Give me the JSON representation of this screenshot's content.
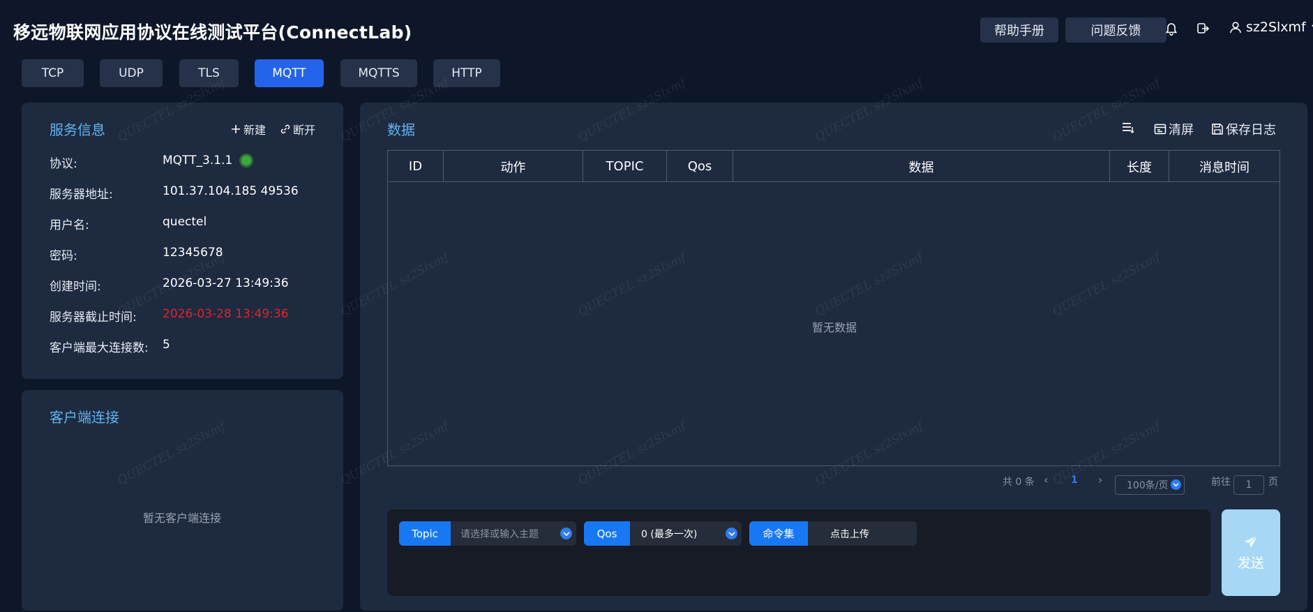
{
  "header": {
    "title": "移远物联网应用协议在线测试平台(ConnectLab)",
    "help_label": "帮助手册",
    "feedback_label": "问题反馈",
    "username": "sz2Slxmf"
  },
  "tabs": [
    {
      "label": "TCP",
      "active": false
    },
    {
      "label": "UDP",
      "active": false
    },
    {
      "label": "TLS",
      "active": false
    },
    {
      "label": "MQTT",
      "active": true
    },
    {
      "label": "MQTTS",
      "active": false
    },
    {
      "label": "HTTP",
      "active": false
    }
  ],
  "service": {
    "title": "服务信息",
    "new_label": "新建",
    "disconnect_label": "断开",
    "rows": [
      {
        "label": "协议:",
        "value": "MQTT_3.1.1"
      },
      {
        "label": "服务器地址:",
        "value": "101.37.104.185 49536"
      },
      {
        "label": "用户名:",
        "value": "quectel"
      },
      {
        "label": "密码:",
        "value": "12345678"
      },
      {
        "label": "创建时间:",
        "value": "2026-03-27 13:49:36"
      },
      {
        "label": "服务器截止时间:",
        "value": "2026-03-28 13:49:36"
      },
      {
        "label": "客户端最大连接数:",
        "value": "5"
      }
    ],
    "status_color": "#3aa83f",
    "expiry_color": "#e0242b"
  },
  "clients": {
    "title": "客户端连接",
    "empty_text": "暂无客户端连接"
  },
  "data_panel": {
    "title": "数据",
    "clear_label": "清屏",
    "save_log_label": "保存日志",
    "columns": [
      "ID",
      "动作",
      "TOPIC",
      "Qos",
      "数据",
      "长度",
      "消息时间"
    ],
    "empty_text": "暂无数据"
  },
  "pagination": {
    "total_text": "共 0 条",
    "current_page": "1",
    "page_size": "100条/页",
    "goto_label": "前往",
    "goto_value": "1",
    "page_unit": "页"
  },
  "send": {
    "topic_tag": "Topic",
    "topic_placeholder": "请选择或输入主题",
    "qos_tag": "Qos",
    "qos_value": "0 (最多一次)",
    "cmd_tag": "命令集",
    "upload_label": "点击上传",
    "send_label": "发送"
  },
  "watermark": "QUECTEL sz2Slxmf",
  "colors": {
    "accent": "#2563eb",
    "title_blue": "#62b4ee",
    "tag_blue": "#1878f4",
    "send_button": "#a6d8f5"
  }
}
